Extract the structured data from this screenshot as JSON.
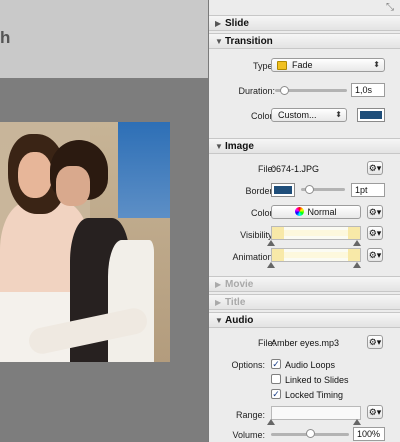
{
  "canvas": {
    "title_stub": "h"
  },
  "sections": {
    "slide": {
      "label": "Slide",
      "expanded": false
    },
    "transition": {
      "label": "Transition",
      "expanded": true,
      "type_label": "Type:",
      "type_value": "Fade",
      "duration_label": "Duration:",
      "duration_value": "1,0s",
      "duration_slider": 0.08,
      "color_label": "Color:",
      "color_popup": "Custom...",
      "color_well": "#1f4e7a"
    },
    "image": {
      "label": "Image",
      "expanded": true,
      "file_label": "File:",
      "file_value": "0674-1.JPG",
      "border_label": "Border:",
      "border_well": "#1f4e7a",
      "border_value": "1pt",
      "border_slider": 0.1,
      "color_label": "Color:",
      "color_value": "Normal",
      "visibility_label": "Visibility:",
      "animation_label": "Animation:"
    },
    "movie": {
      "label": "Movie",
      "expanded": false,
      "enabled": false
    },
    "title": {
      "label": "Title",
      "expanded": false,
      "enabled": false
    },
    "audio": {
      "label": "Audio",
      "expanded": true,
      "file_label": "File:",
      "file_value": "Amber eyes.mp3",
      "options_label": "Options:",
      "options": [
        {
          "label": "Audio Loops",
          "checked": true
        },
        {
          "label": "Linked to Slides",
          "checked": false
        },
        {
          "label": "Locked Timing",
          "checked": true
        }
      ],
      "range_label": "Range:",
      "volume_label": "Volume:",
      "volume_value": "100%",
      "volume_slider": 0.5
    }
  },
  "icons": {
    "gear": "gear-icon",
    "resize": "resize-icon",
    "disclosure_open": "triangle-down-icon",
    "disclosure_closed": "triangle-right-icon"
  },
  "glyphs": {
    "gear": "⚙▾",
    "open": "▼",
    "closed": "▶",
    "popup_arrows": "⬍",
    "check": "✓",
    "resize": "⤡"
  }
}
